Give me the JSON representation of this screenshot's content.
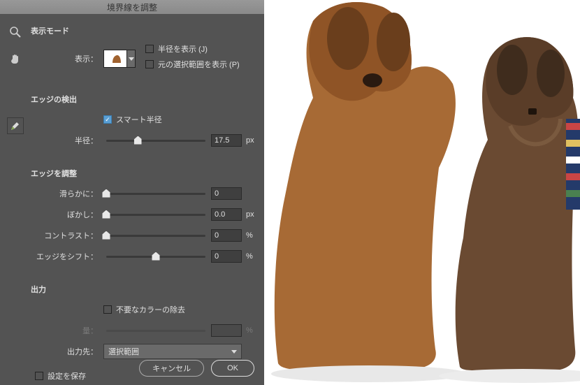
{
  "title": "境界線を調整",
  "sections": {
    "view_mode": {
      "heading": "表示モード",
      "view_label": "表示：",
      "show_radius": "半径を表示 (J)",
      "show_original": "元の選択範囲を表示 (P)"
    },
    "edge_detection": {
      "heading": "エッジの検出",
      "smart_radius": "スマート半径",
      "radius_label": "半径：",
      "radius_value": "17.5",
      "radius_unit": "px"
    },
    "edge_adjust": {
      "heading": "エッジを調整",
      "smooth_label": "滑らかに：",
      "smooth_value": "0",
      "feather_label": "ぼかし：",
      "feather_value": "0.0",
      "feather_unit": "px",
      "contrast_label": "コントラスト：",
      "contrast_value": "0",
      "contrast_unit": "%",
      "shift_label": "エッジをシフト：",
      "shift_value": "0",
      "shift_unit": "%"
    },
    "output": {
      "heading": "出力",
      "decontaminate": "不要なカラーの除去",
      "amount_label": "量：",
      "amount_unit": "%",
      "output_to_label": "出力先：",
      "output_to_value": "選択範囲"
    },
    "remember": "設定を保存"
  },
  "buttons": {
    "cancel": "キャンセル",
    "ok": "OK"
  },
  "icons": {
    "zoom": "zoom-icon",
    "hand": "hand-icon",
    "brush": "brush-icon"
  }
}
